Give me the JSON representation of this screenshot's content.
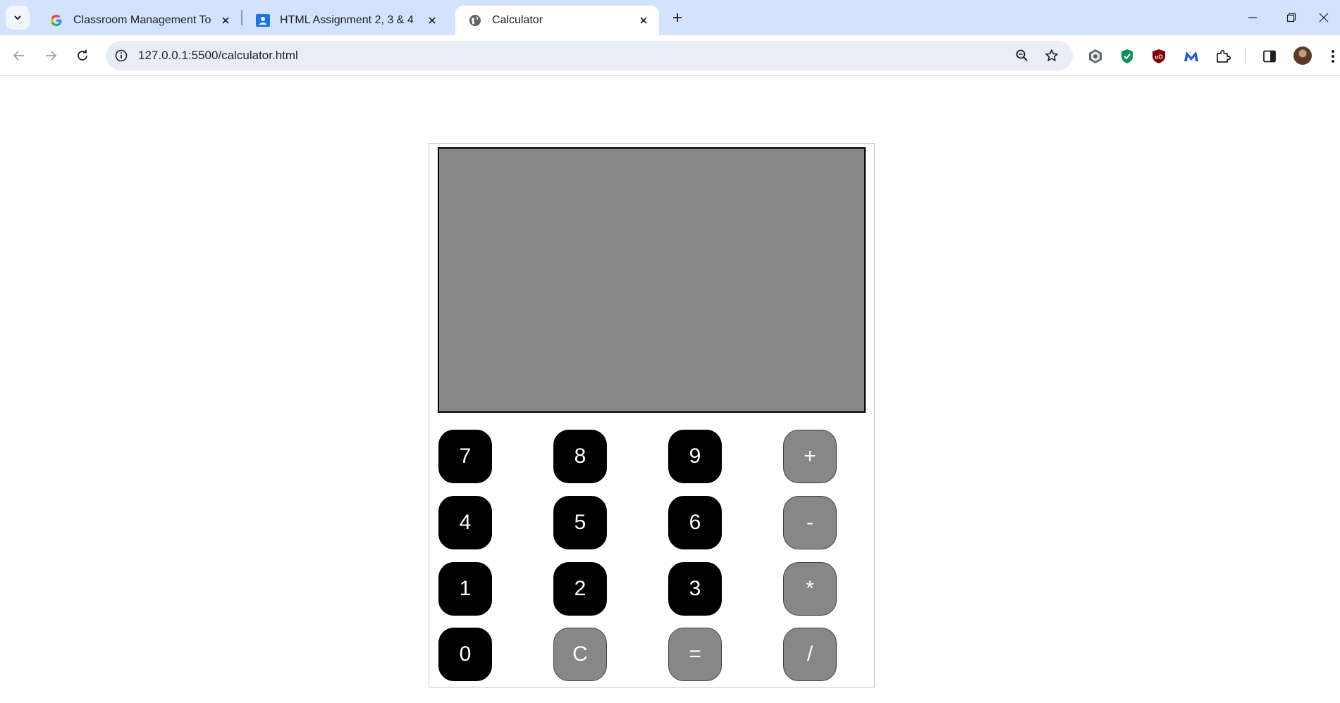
{
  "browser": {
    "tabs": [
      {
        "title": "Classroom Management Tools & ",
        "favicon": "google-icon",
        "active": false
      },
      {
        "title": "HTML Assignment 2, 3 & 4",
        "favicon": "classroom-icon",
        "active": false
      },
      {
        "title": "Calculator",
        "favicon": "globe-icon",
        "active": true
      }
    ],
    "address": {
      "url": "127.0.0.1:5500/calculator.html"
    },
    "colors": {
      "tabstrip": "#d3e3fd",
      "omnibox": "#e9eef6"
    }
  },
  "calculator": {
    "display": {
      "value": ""
    },
    "keys": {
      "k7": "7",
      "k8": "8",
      "k9": "9",
      "plus": "+",
      "k4": "4",
      "k5": "5",
      "k6": "6",
      "minus": "-",
      "k1": "1",
      "k2": "2",
      "k3": "3",
      "multiply": "*",
      "k0": "0",
      "clear": "C",
      "equals": "=",
      "divide": "/"
    },
    "colors": {
      "number_key": "#000000",
      "operator_key": "#878787",
      "display": "#878787"
    }
  }
}
